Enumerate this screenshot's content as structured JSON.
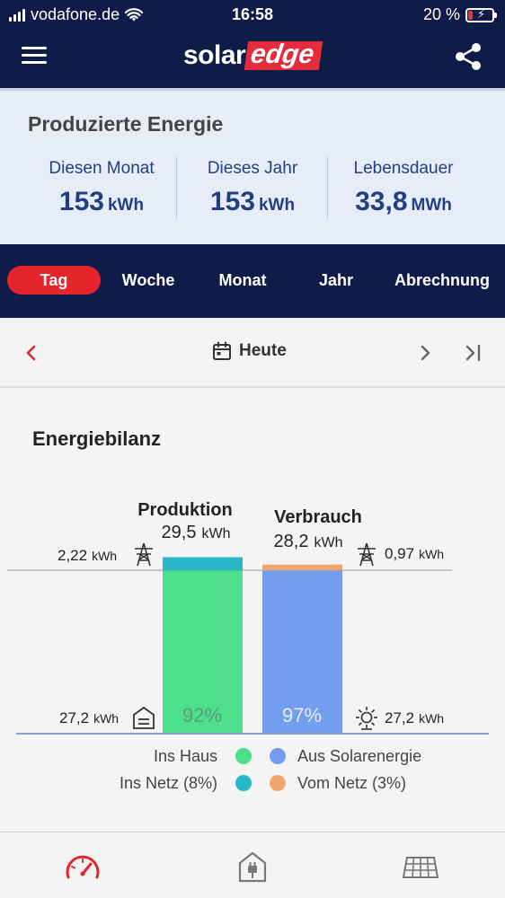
{
  "status_bar": {
    "carrier": "vodafone.de",
    "time": "16:58",
    "battery": "20 %",
    "battery_level_percent": 20
  },
  "header": {
    "logo_solar": "solar",
    "logo_edge": "edge",
    "menu_icon": "hamburger-menu-icon",
    "share_icon": "share-icon"
  },
  "produced_energy": {
    "title": "Produzierte Energie",
    "stats": [
      {
        "label": "Diesen Monat",
        "value": "153",
        "unit": "kWh"
      },
      {
        "label": "Dieses Jahr",
        "value": "153",
        "unit": "kWh"
      },
      {
        "label": "Lebensdauer",
        "value": "33,8",
        "unit": "MWh"
      }
    ]
  },
  "tabs": {
    "items": [
      "Tag",
      "Woche",
      "Monat",
      "Jahr",
      "Abrechnung"
    ],
    "active": "Tag"
  },
  "date_nav": {
    "label": "Heute",
    "prev_icon": "chevron-left-icon",
    "next_icon": "chevron-right-icon",
    "last_icon": "skip-to-end-icon",
    "calendar_icon": "calendar-icon"
  },
  "energy_balance": {
    "title": "Energiebilanz"
  },
  "chart_data": {
    "type": "bar",
    "categories": [
      "Produktion",
      "Verbrauch"
    ],
    "totals": [
      {
        "label": "Produktion",
        "value": "29,5",
        "unit": "kWh"
      },
      {
        "label": "Verbrauch",
        "value": "28,2",
        "unit": "kWh"
      }
    ],
    "series": [
      {
        "name": "Ins Haus",
        "color": "#4ddf8c",
        "values": [
          27.2,
          0
        ]
      },
      {
        "name": "Ins Netz (8%)",
        "color": "#2ab7c7",
        "values": [
          2.22,
          0
        ]
      },
      {
        "name": "Aus Solarenergie",
        "color": "#739ef0",
        "values": [
          0,
          27.2
        ]
      },
      {
        "name": "Vom Netz (3%)",
        "color": "#f0a46e",
        "values": [
          0,
          0.97
        ]
      }
    ],
    "bar_percent_labels": [
      "92%",
      "97%"
    ],
    "side_values": {
      "production_grid": {
        "value": "2,22",
        "unit": "kWh"
      },
      "production_house": {
        "value": "27,2",
        "unit": "kWh"
      },
      "consumption_grid": {
        "value": "0,97",
        "unit": "kWh"
      },
      "consumption_solar": {
        "value": "27,2",
        "unit": "kWh"
      }
    },
    "legend_placement": "bottom",
    "ylim": [
      0,
      29.5
    ]
  },
  "bottom_nav": {
    "items": [
      {
        "icon": "dashboard-gauge-icon",
        "active": true,
        "color": "#e5242b"
      },
      {
        "icon": "house-plug-icon",
        "active": false,
        "color": "#777777"
      },
      {
        "icon": "solar-panel-icon",
        "active": false,
        "color": "#777777"
      }
    ]
  },
  "colors": {
    "navy": "#0f1c48",
    "accent_red": "#e5242b",
    "summary_bg": "#e6edf7",
    "stat_blue": "#233f82"
  }
}
